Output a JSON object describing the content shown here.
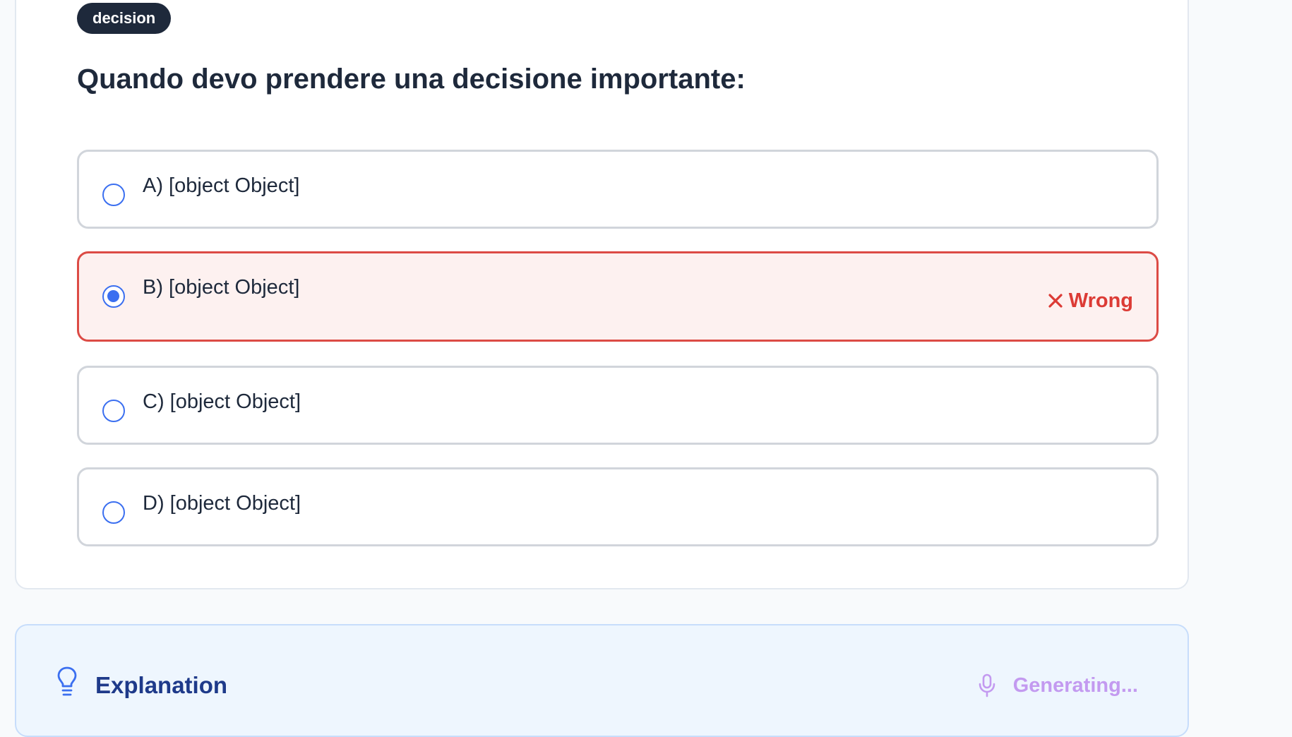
{
  "question": {
    "tag": "decision",
    "title": "Quando devo prendere una decisione importante:",
    "options": [
      {
        "label": "A) [object Object]",
        "selected": false,
        "status": ""
      },
      {
        "label": "B) [object Object]",
        "selected": true,
        "status": "Wrong"
      },
      {
        "label": "C) [object Object]",
        "selected": false,
        "status": ""
      },
      {
        "label": "D) [object Object]",
        "selected": false,
        "status": ""
      }
    ],
    "status_icon": "close-icon"
  },
  "explanation": {
    "title": "Explanation",
    "icon": "lightbulb-icon",
    "audio_status": "Generating...",
    "audio_icon": "microphone-icon"
  },
  "colors": {
    "accent": "#3b6ff0",
    "wrong": "#dc3b35",
    "wrong_bg": "#fdf1f0",
    "explanation_bg": "#eef6fe",
    "explanation_title": "#1e3a8a",
    "generating": "#c39af0"
  }
}
